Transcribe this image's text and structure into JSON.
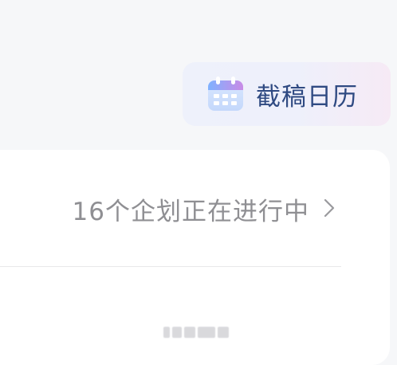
{
  "deadline_calendar": {
    "label": "截稿日历",
    "icon": "calendar-icon"
  },
  "plans": {
    "label": "16个企划正在进行中"
  },
  "colors": {
    "background": "#f6f7f9",
    "card": "#ffffff",
    "accent_text": "#2f4a82",
    "muted_text": "#8f8f93"
  }
}
